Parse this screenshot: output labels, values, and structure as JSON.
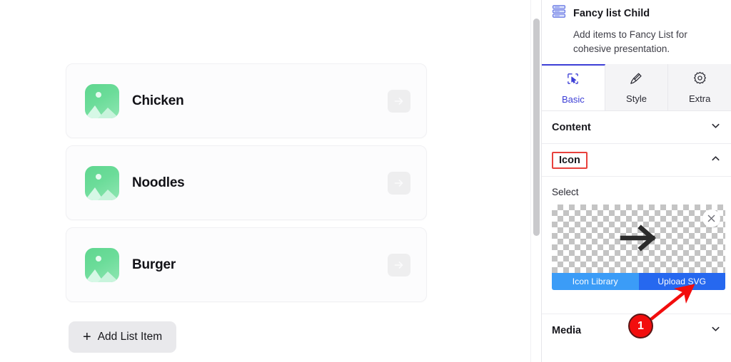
{
  "canvas": {
    "list_items": [
      {
        "title": "Chicken",
        "thumb_icon": "image-placeholder-icon",
        "action_icon": "arrow-right-icon"
      },
      {
        "title": "Noodles",
        "thumb_icon": "image-placeholder-icon",
        "action_icon": "arrow-right-icon"
      },
      {
        "title": "Burger",
        "thumb_icon": "image-placeholder-icon",
        "action_icon": "arrow-right-icon"
      }
    ],
    "add_button": {
      "plus": "+",
      "label": "Add List Item"
    }
  },
  "scrollbar": {
    "name": "vertical-scrollbar"
  },
  "panel": {
    "header": {
      "icon": "list-stack-icon",
      "title": "Fancy list Child",
      "description": "Add items to Fancy List for cohesive presentation."
    },
    "tabs": [
      {
        "label": "Basic",
        "icon": "cursor-select-icon",
        "active": true
      },
      {
        "label": "Style",
        "icon": "paint-brush-icon",
        "active": false
      },
      {
        "label": "Extra",
        "icon": "gear-icon",
        "active": false
      }
    ],
    "sections": {
      "content": {
        "label": "Content",
        "chevron": "chevron-down-icon",
        "expanded": false
      },
      "icon": {
        "label": "Icon",
        "chevron": "chevron-up-icon",
        "expanded": true,
        "highlighted": true
      },
      "media": {
        "label": "Media",
        "chevron": "chevron-down-icon",
        "expanded": false
      }
    },
    "icon_section": {
      "select_label": "Select",
      "preview": {
        "art": "arrow-right-icon",
        "close": "close-icon",
        "background": "transparency-checkerboard"
      },
      "buttons": [
        {
          "label": "Icon Library",
          "color": "#3b9cf7"
        },
        {
          "label": "Upload SVG",
          "color": "#2668ef"
        }
      ]
    }
  },
  "annotation": {
    "badge_number": "1",
    "badge_color": "#f20d0d",
    "arrow_color": "#f20d0d",
    "highlight_color": "#e8413c"
  }
}
